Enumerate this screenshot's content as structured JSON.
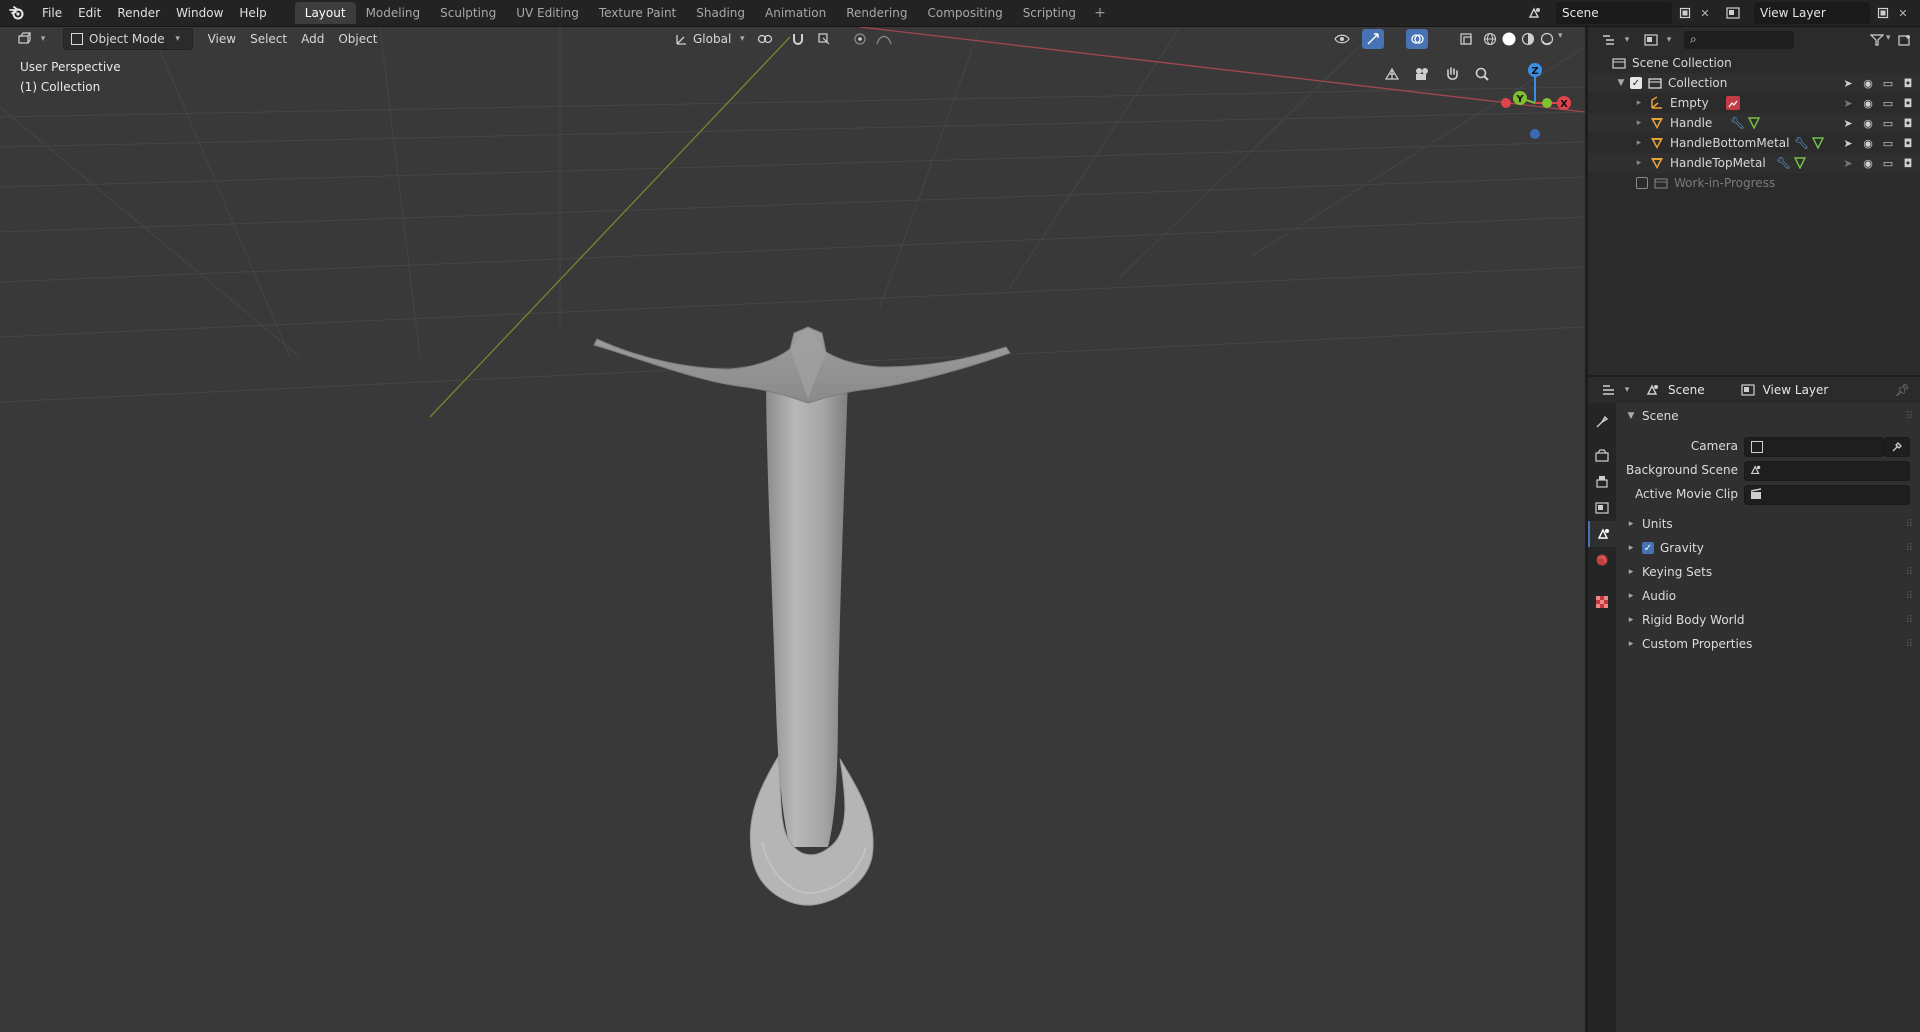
{
  "topbar": {
    "menus": [
      "File",
      "Edit",
      "Render",
      "Window",
      "Help"
    ],
    "workspaces": [
      "Layout",
      "Modeling",
      "Sculpting",
      "UV Editing",
      "Texture Paint",
      "Shading",
      "Animation",
      "Rendering",
      "Compositing",
      "Scripting"
    ],
    "active_workspace": "Layout",
    "add_label": "+",
    "scene_name": "Scene",
    "view_layer_name": "View Layer"
  },
  "viewport": {
    "mode": "Object Mode",
    "menus": [
      "View",
      "Select",
      "Add",
      "Object"
    ],
    "transform_orientation": "Global",
    "overlay_title": "User Perspective",
    "overlay_collection": "(1) Collection",
    "gizmo": {
      "x": "X",
      "y": "Y",
      "z": "Z"
    }
  },
  "outliner": {
    "root": "Scene Collection",
    "items": [
      {
        "name": "Collection",
        "type": "collection"
      },
      {
        "name": "Empty",
        "type": "empty"
      },
      {
        "name": "Handle",
        "type": "mesh"
      },
      {
        "name": "HandleBottomMetal",
        "type": "mesh"
      },
      {
        "name": "HandleTopMetal",
        "type": "mesh"
      },
      {
        "name": "Work-in-Progress",
        "type": "collection-disabled"
      }
    ]
  },
  "properties": {
    "tabs": {
      "scene": "Scene",
      "view_layer": "View Layer"
    },
    "panel_title": "Scene",
    "fields": {
      "camera": "Camera",
      "background_scene": "Background Scene",
      "active_movie_clip": "Active Movie Clip"
    },
    "sections": [
      "Units",
      "Gravity",
      "Keying Sets",
      "Audio",
      "Rigid Body World",
      "Custom Properties"
    ],
    "gravity_enabled": true
  },
  "colors": {
    "accent_blue": "#4772b3",
    "axis_x": "#e0444a",
    "axis_y": "#80c030",
    "axis_z": "#3a8ee6",
    "object_orange": "#e8a23a"
  }
}
